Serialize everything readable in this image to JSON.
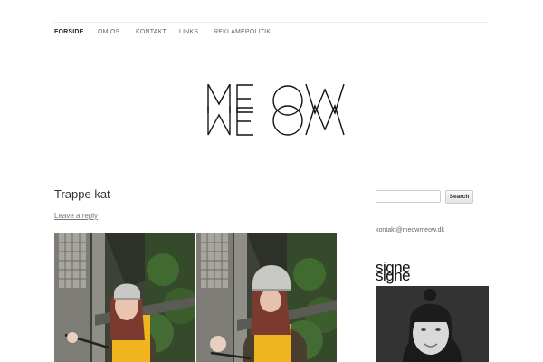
{
  "nav": {
    "items": [
      {
        "label": "FORSIDE",
        "active": true
      },
      {
        "label": "OM OS"
      },
      {
        "label": "KONTAKT"
      },
      {
        "label": "LINKS"
      },
      {
        "label": "REKLAMEPOLITIK"
      }
    ]
  },
  "site": {
    "logo_text": "MEOW"
  },
  "post": {
    "title": "Trappe kat",
    "leave_reply": "Leave a reply"
  },
  "sidebar": {
    "search": {
      "placeholder": "",
      "button_label": "Search"
    },
    "contact_email": "kontakt@meowmeow.dk",
    "widget_title": "signe"
  },
  "colors": {
    "text": "#333333",
    "border": "#ececec",
    "link": "#666666"
  },
  "icons": {
    "logo": "meow-logo"
  }
}
